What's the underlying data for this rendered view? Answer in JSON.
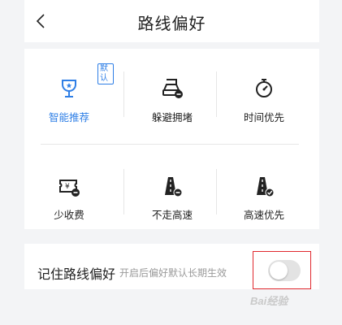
{
  "header": {
    "title": "路线偏好",
    "back_icon": "chevron-left-icon"
  },
  "options": [
    {
      "label": "智能推荐",
      "icon": "trophy-icon",
      "selected": true,
      "badge": "默认"
    },
    {
      "label": "躲避拥堵",
      "icon": "car-avoid-icon",
      "selected": false
    },
    {
      "label": "时间优先",
      "icon": "stopwatch-icon",
      "selected": false
    },
    {
      "label": "少收费",
      "icon": "ticket-icon",
      "selected": false
    },
    {
      "label": "不走高速",
      "icon": "highway-no-icon",
      "selected": false
    },
    {
      "label": "高速优先",
      "icon": "highway-check-icon",
      "selected": false
    }
  ],
  "remember": {
    "label": "记住路线偏好",
    "description": "开启后偏好默认长期生效",
    "toggle_on": false
  },
  "watermark": "Bai经验",
  "colors": {
    "accent": "#2f7fe6",
    "highlight_box": "#e0282e",
    "text": "#1f1f1f"
  }
}
